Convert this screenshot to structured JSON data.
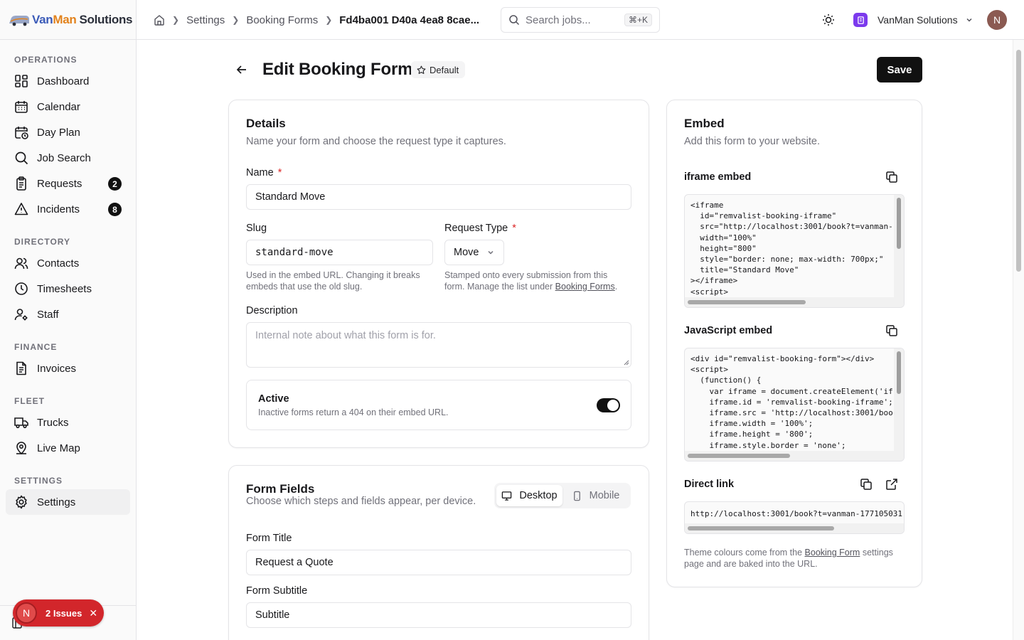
{
  "brand": {
    "van": "Van",
    "man": "Man",
    "rest": "Solutions"
  },
  "sidebar": {
    "sections": [
      {
        "heading": "OPERATIONS",
        "items": [
          {
            "label": "Dashboard",
            "icon": "dashboard-icon"
          },
          {
            "label": "Calendar",
            "icon": "calendar-icon"
          },
          {
            "label": "Day Plan",
            "icon": "day-plan-icon"
          },
          {
            "label": "Job Search",
            "icon": "search-icon"
          },
          {
            "label": "Requests",
            "icon": "clipboard-icon",
            "badge": "2"
          },
          {
            "label": "Incidents",
            "icon": "warning-icon",
            "badge": "8"
          }
        ]
      },
      {
        "heading": "DIRECTORY",
        "items": [
          {
            "label": "Contacts",
            "icon": "users-icon"
          },
          {
            "label": "Timesheets",
            "icon": "clock-icon"
          },
          {
            "label": "Staff",
            "icon": "user-cog-icon"
          }
        ]
      },
      {
        "heading": "FINANCE",
        "items": [
          {
            "label": "Invoices",
            "icon": "invoice-icon"
          }
        ]
      },
      {
        "heading": "FLEET",
        "items": [
          {
            "label": "Trucks",
            "icon": "truck-icon"
          },
          {
            "label": "Live Map",
            "icon": "map-pin-icon"
          }
        ]
      },
      {
        "heading": "SETTINGS",
        "items": [
          {
            "label": "Settings",
            "icon": "gear-icon",
            "active": true
          }
        ]
      }
    ]
  },
  "issues": {
    "avatar": "N",
    "label": "2 Issues"
  },
  "topbar": {
    "breadcrumbs": [
      "Settings",
      "Booking Forms",
      "Fd4ba001 D40a 4ea8 8cae..."
    ],
    "search_placeholder": "Search jobs...",
    "search_shortcut": "⌘+K",
    "org_name": "VanMan Solutions",
    "user_initial": "N"
  },
  "header": {
    "title": "Edit Booking Form",
    "badge": "Default",
    "save_label": "Save"
  },
  "details": {
    "title": "Details",
    "subtitle": "Name your form and choose the request type it captures.",
    "name_label": "Name",
    "name_value": "Standard Move",
    "slug_label": "Slug",
    "slug_value": "standard-move",
    "slug_hint_1": "Used in the embed URL. Changing it breaks",
    "slug_hint_2": "embeds that use the old slug.",
    "request_type_label": "Request Type",
    "request_type_value": "Move",
    "request_hint_1": "Stamped onto every submission from this",
    "request_hint_2": "form. Manage the list under",
    "request_hint_link": "Booking Forms",
    "description_label": "Description",
    "description_placeholder": "Internal note about what this form is for.",
    "active_title": "Active",
    "active_desc": "Inactive forms return a 404 on their embed URL.",
    "active_on": true
  },
  "form_fields": {
    "title": "Form Fields",
    "subtitle": "Choose which steps and fields appear, per device.",
    "tab_desktop": "Desktop",
    "tab_mobile": "Mobile",
    "form_title_label": "Form Title",
    "form_title_value": "Request a Quote",
    "form_subtitle_label": "Form Subtitle",
    "form_subtitle_value": "Subtitle"
  },
  "embed": {
    "title": "Embed",
    "subtitle": "Add this form to your website.",
    "iframe_label": "iframe embed",
    "iframe_code": "<iframe\n  id=\"remvalist-booking-iframe\"\n  src=\"http://localhost:3001/book?t=vanman-\n  width=\"100%\"\n  height=\"800\"\n  style=\"border: none; max-width: 700px;\"\n  title=\"Standard Move\"\n></iframe>\n<script>",
    "js_label": "JavaScript embed",
    "js_code": "<div id=\"remvalist-booking-form\"></div>\n<script>\n  (function() {\n    var iframe = document.createElement('if\n    iframe.id = 'remvalist-booking-iframe';\n    iframe.src = 'http://localhost:3001/boo\n    iframe.width = '100%';\n    iframe.height = '800';\n    iframe.style.border = 'none';",
    "link_label": "Direct link",
    "link_value": "http://localhost:3001/book?t=vanman-177105031",
    "footnote_1": "Theme colours come from the",
    "footnote_link": "Booking Form",
    "footnote_2": "settings",
    "footnote_3": "page and are baked into the URL."
  }
}
